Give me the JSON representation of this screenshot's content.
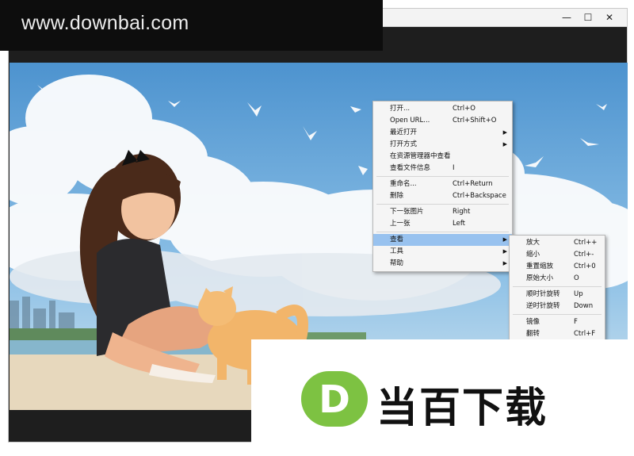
{
  "watermark": {
    "text": "www.downbai.com"
  },
  "brand": {
    "logo_letter": "D",
    "name": "当百下载"
  },
  "window_controls": {
    "minimize": "—",
    "maximize": "☐",
    "close": "✕"
  },
  "context_menu": {
    "items": [
      {
        "label": "打开...",
        "shortcut": "Ctrl+O"
      },
      {
        "label": "Open URL...",
        "shortcut": "Ctrl+Shift+O"
      },
      {
        "label": "最近打开",
        "submenu": true
      },
      {
        "label": "打开方式",
        "submenu": true
      },
      {
        "label": "在资源管理器中查看"
      },
      {
        "label": "查看文件信息",
        "shortcut": "I"
      },
      {
        "label": "重命名...",
        "shortcut": "Ctrl+Return"
      },
      {
        "label": "删除",
        "shortcut": "Ctrl+Backspace"
      },
      {
        "label": "下一张图片",
        "shortcut": "Right"
      },
      {
        "label": "上一张",
        "shortcut": "Left"
      },
      {
        "label": "查看",
        "submenu": true,
        "selected": true
      },
      {
        "label": "工具",
        "submenu": true
      },
      {
        "label": "帮助",
        "submenu": true
      }
    ]
  },
  "view_submenu": {
    "items": [
      {
        "label": "放大",
        "shortcut": "Ctrl++"
      },
      {
        "label": "缩小",
        "shortcut": "Ctrl+-"
      },
      {
        "label": "重置缩放",
        "shortcut": "Ctrl+0"
      },
      {
        "label": "原始大小",
        "shortcut": "O"
      },
      {
        "label": "顺时针旋转",
        "shortcut": "Up"
      },
      {
        "label": "逆时针旋转",
        "shortcut": "Down"
      },
      {
        "label": "镜像",
        "shortcut": "F"
      },
      {
        "label": "翻转",
        "shortcut": "Ctrl+F"
      }
    ]
  },
  "colors": {
    "menu_highlight": "#98c2ef",
    "brand_green": "#7dc242",
    "sky": "#5a9fd6"
  }
}
